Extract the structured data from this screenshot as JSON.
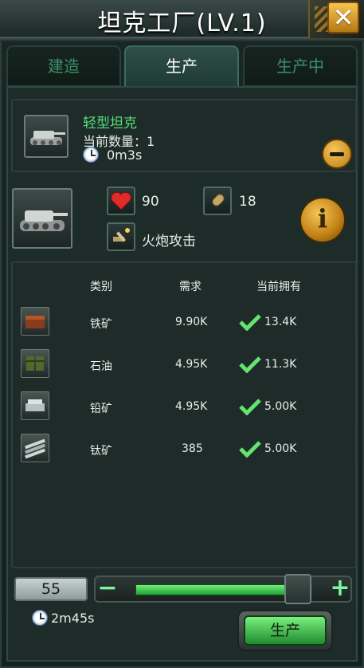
{
  "header": {
    "title": "坦克工厂(LV.1)",
    "close_icon": "close-icon"
  },
  "tabs": [
    {
      "label": "建造",
      "active": false
    },
    {
      "label": "生产",
      "active": true
    },
    {
      "label": "生产中",
      "active": false
    }
  ],
  "queue": {
    "unit_name": "轻型坦克",
    "count_label": "当前数量：1",
    "time": "0m3s"
  },
  "unit": {
    "hp": "90",
    "attack": "18",
    "attack_type": "火炮攻击"
  },
  "table": {
    "headers": [
      "类别",
      "需求",
      "当前拥有"
    ],
    "rows": [
      {
        "icon": "iron-ore-icon",
        "name": "铁矿",
        "required": "9.90K",
        "owned": "13.4K"
      },
      {
        "icon": "oil-barrel-icon",
        "name": "石油",
        "required": "4.95K",
        "owned": "11.3K"
      },
      {
        "icon": "lead-ingot-icon",
        "name": "铅矿",
        "required": "4.95K",
        "owned": "5.00K"
      },
      {
        "icon": "titanium-rods-icon",
        "name": "钛矿",
        "required": "385",
        "owned": "5.00K"
      }
    ]
  },
  "production": {
    "quantity": "55",
    "slider_fraction": 0.92,
    "total_time": "2m45s",
    "produce_label": "生产"
  },
  "colors": {
    "accent_green": "#52e07b",
    "gold": "#f0b43a"
  }
}
